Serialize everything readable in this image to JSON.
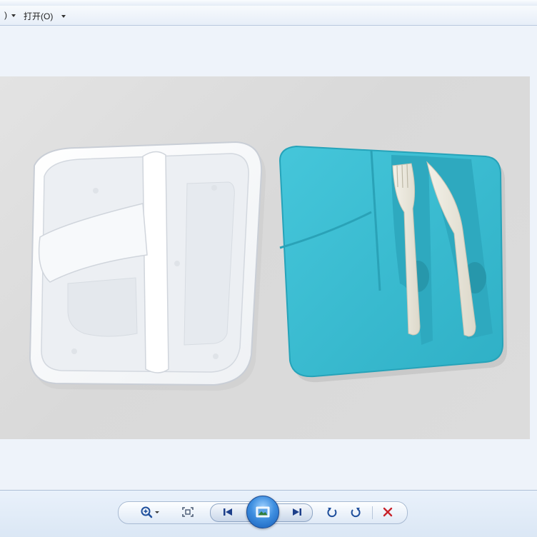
{
  "menubar": {
    "items": [
      {
        "label": ""
      },
      {
        "label": "打开(O)"
      }
    ]
  },
  "toolbar": {
    "buttons": [
      {
        "icon": "zoom-icon",
        "dropdown": true
      },
      {
        "icon": "actual-size-icon"
      },
      {
        "icon": "previous-icon"
      },
      {
        "icon": "slideshow-icon"
      },
      {
        "icon": "next-icon"
      },
      {
        "icon": "rotate-counterclockwise-icon"
      },
      {
        "icon": "rotate-clockwise-icon"
      },
      {
        "icon": "delete-icon"
      }
    ]
  },
  "image": {
    "description_icon": "photo",
    "colors": {
      "lid": "#3bbcd0",
      "tray": "#f4f7fa",
      "background": "#dcdcdc"
    }
  }
}
